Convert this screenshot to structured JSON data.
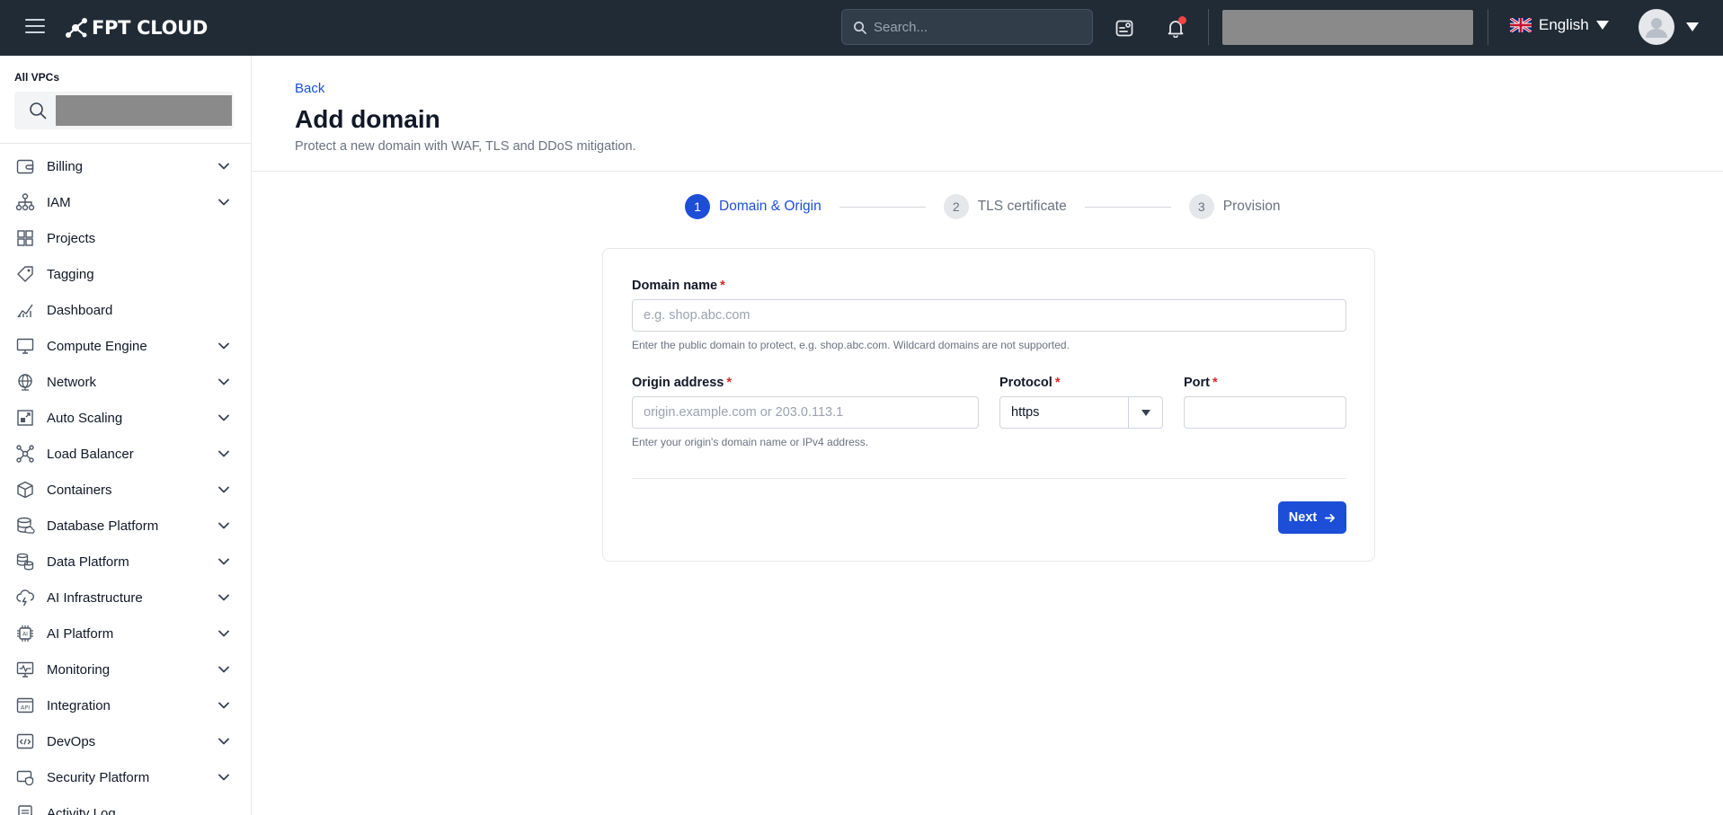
{
  "header": {
    "brand": "FPT CLOUD",
    "search_placeholder": "Search...",
    "language": "English",
    "icons": [
      "menu-icon",
      "logo-icon",
      "search-icon",
      "user-card-icon",
      "bell-icon",
      "uk-flag-icon",
      "avatar-icon"
    ]
  },
  "sidebar": {
    "vpc_label": "All VPCs",
    "items": [
      {
        "label": "Billing",
        "icon": "wallet-icon",
        "expandable": true
      },
      {
        "label": "IAM",
        "icon": "hierarchy-icon",
        "expandable": true
      },
      {
        "label": "Projects",
        "icon": "grid-icon",
        "expandable": false
      },
      {
        "label": "Tagging",
        "icon": "tag-icon",
        "expandable": false
      },
      {
        "label": "Dashboard",
        "icon": "chart-icon",
        "expandable": false
      },
      {
        "label": "Compute Engine",
        "icon": "monitor-icon",
        "expandable": true
      },
      {
        "label": "Network",
        "icon": "globe-icon",
        "expandable": true
      },
      {
        "label": "Auto Scaling",
        "icon": "scaling-icon",
        "expandable": true
      },
      {
        "label": "Load Balancer",
        "icon": "nodes-icon",
        "expandable": true
      },
      {
        "label": "Containers",
        "icon": "box-icon",
        "expandable": true
      },
      {
        "label": "Database Platform",
        "icon": "database-icon",
        "expandable": true
      },
      {
        "label": "Data Platform",
        "icon": "data-stack-icon",
        "expandable": true
      },
      {
        "label": "AI Infrastructure",
        "icon": "cloud-bolt-icon",
        "expandable": true
      },
      {
        "label": "AI Platform",
        "icon": "chip-icon",
        "expandable": true
      },
      {
        "label": "Monitoring",
        "icon": "pulse-monitor-icon",
        "expandable": true
      },
      {
        "label": "Integration",
        "icon": "api-icon",
        "expandable": true
      },
      {
        "label": "DevOps",
        "icon": "code-window-icon",
        "expandable": true
      },
      {
        "label": "Security Platform",
        "icon": "shield-card-icon",
        "expandable": true
      },
      {
        "label": "Activity Log",
        "icon": "log-icon",
        "expandable": false
      }
    ]
  },
  "page": {
    "back_label": "Back",
    "title": "Add domain",
    "subtitle": "Protect a new domain with WAF, TLS and DDoS mitigation."
  },
  "steps": [
    {
      "number": "1",
      "label": "Domain & Origin",
      "active": true
    },
    {
      "number": "2",
      "label": "TLS certificate",
      "active": false
    },
    {
      "number": "3",
      "label": "Provision",
      "active": false
    }
  ],
  "form": {
    "required_mark": "*",
    "domain_label": "Domain name",
    "domain_placeholder": "e.g. shop.abc.com",
    "domain_value": "",
    "domain_hint": "Enter the public domain to protect, e.g. shop.abc.com. Wildcard domains are not supported.",
    "origin_label": "Origin address",
    "origin_placeholder": "origin.example.com or 203.0.113.1",
    "origin_value": "",
    "origin_hint": "Enter your origin's domain name or IPv4 address.",
    "protocol_label": "Protocol",
    "protocol_value": "https",
    "port_label": "Port",
    "port_value": "",
    "next_label": "Next"
  },
  "colors": {
    "topbar": "#212b36",
    "accent": "#1d4ed8",
    "required": "#dc2626",
    "notification_dot": "#ef4444"
  }
}
